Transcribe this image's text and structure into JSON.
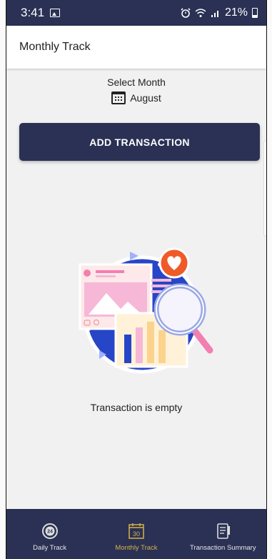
{
  "status_bar": {
    "time": "3:41",
    "battery": "21%"
  },
  "app_bar": {
    "title": "Monthly Track"
  },
  "month_selector": {
    "label": "Select Month",
    "value": "August"
  },
  "add_button": {
    "label": "ADD TRANSACTION"
  },
  "empty_state": {
    "message": "Transaction is empty"
  },
  "bottom_nav": {
    "items": [
      {
        "label": "Daily Track"
      },
      {
        "label": "Monthly Track",
        "active": true,
        "day": "30"
      },
      {
        "label": "Transaction Summary"
      }
    ]
  },
  "colors": {
    "primary": "#2a3154",
    "active_nav": "#d4b24a",
    "background": "#f1f1f1"
  }
}
